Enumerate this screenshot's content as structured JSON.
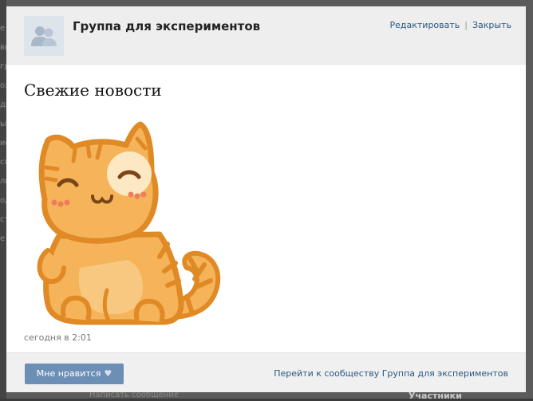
{
  "header": {
    "group_name": "Группа для экспериментов",
    "edit_label": "Редактировать",
    "separator": "|",
    "close_label": "Закрыть"
  },
  "post": {
    "title": "Свежие новости",
    "time": "сегодня в 2:01"
  },
  "footer": {
    "like_label": "Мне нравится",
    "like_icon": "heart-icon",
    "community_link": "Перейти к сообществу Группа для экспериментов"
  },
  "background": {
    "left_fragments": [
      "е",
      "вы",
      "гр",
      "оз",
      "ди",
      "ы",
      "ис",
      "сп",
      "ль",
      "од",
      "ст",
      "е"
    ],
    "right_panel_title": "Участники",
    "bottom_fragment": "Написать сообщение"
  },
  "colors": {
    "overlay": "#5b5b5b",
    "header_bg": "#eeeeee",
    "link": "#2a5885",
    "button": "#6d8fb5"
  }
}
